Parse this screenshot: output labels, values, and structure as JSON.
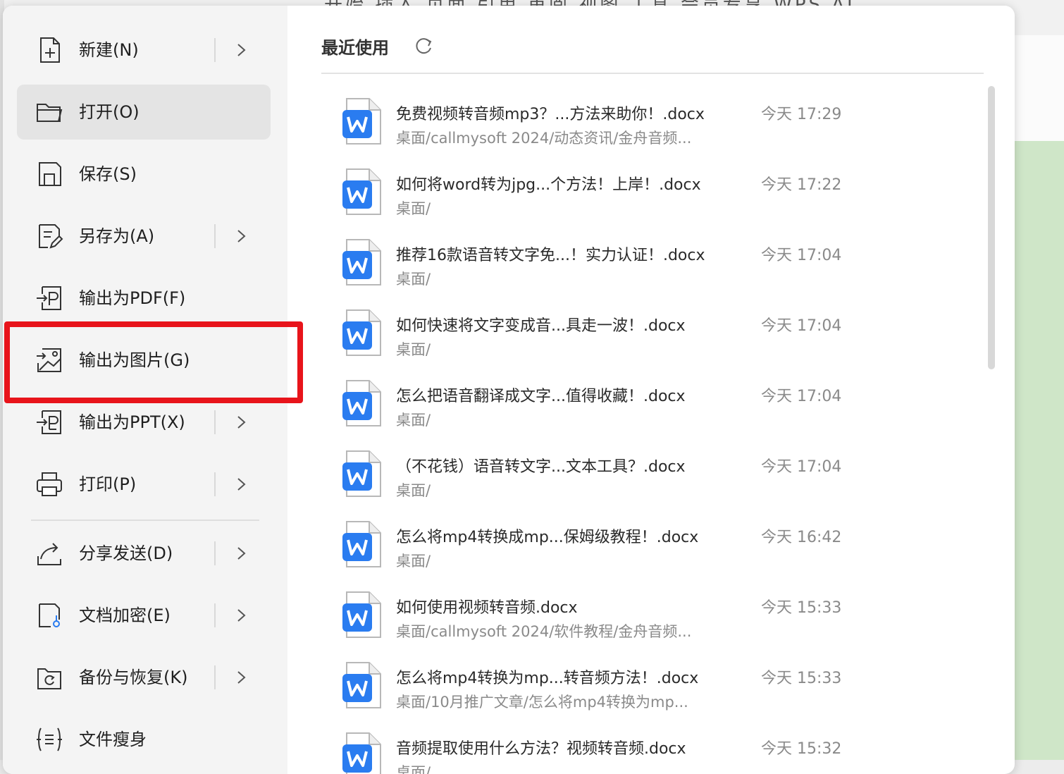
{
  "background": {
    "ribbon_tabs": "开始  插入  页面  引用  审阅  视图  工具  会员专享  WPS AI"
  },
  "menu_left": {
    "items": [
      {
        "label": "新建(N)",
        "icon": "new-document-icon",
        "has_submenu": true
      },
      {
        "label": "打开(O)",
        "icon": "folder-open-icon",
        "has_submenu": false
      },
      {
        "label": "保存(S)",
        "icon": "save-icon",
        "has_submenu": false
      },
      {
        "label": "另存为(A)",
        "icon": "save-as-icon",
        "has_submenu": true
      },
      {
        "label": "输出为PDF(F)",
        "icon": "export-pdf-icon",
        "has_submenu": false
      },
      {
        "label": "输出为图片(G)",
        "icon": "export-image-icon",
        "has_submenu": false
      },
      {
        "label": "输出为PPT(X)",
        "icon": "export-ppt-icon",
        "has_submenu": true
      },
      {
        "label": "打印(P)",
        "icon": "printer-icon",
        "has_submenu": true
      },
      {
        "label": "分享发送(D)",
        "icon": "share-icon",
        "has_submenu": true
      },
      {
        "label": "文档加密(E)",
        "icon": "encrypt-document-icon",
        "has_submenu": true
      },
      {
        "label": "备份与恢复(K)",
        "icon": "backup-restore-icon",
        "has_submenu": true
      },
      {
        "label": "文件瘦身",
        "icon": "file-slim-icon",
        "has_submenu": false
      }
    ]
  },
  "recent": {
    "title": "最近使用",
    "files": [
      {
        "name": "免费视频转音频mp3？...方法来助你！.docx",
        "path": "桌面/callmysoft 2024/动态资讯/金舟音频...",
        "time": "今天 17:29"
      },
      {
        "name": "如何将word转为jpg...个方法！上岸！.docx",
        "path": "桌面/",
        "time": "今天 17:22"
      },
      {
        "name": "推荐16款语音转文字免...！实力认证！.docx",
        "path": "桌面/",
        "time": "今天 17:04"
      },
      {
        "name": "如何快速将文字变成音...具走一波！.docx",
        "path": "桌面/",
        "time": "今天 17:04"
      },
      {
        "name": "怎么把语音翻译成文字...值得收藏！.docx",
        "path": "桌面/",
        "time": "今天 17:04"
      },
      {
        "name": "（不花钱）语音转文字...文本工具？.docx",
        "path": "桌面/",
        "time": "今天 17:04"
      },
      {
        "name": "怎么将mp4转换成mp...保姆级教程！.docx",
        "path": "桌面/",
        "time": "今天 16:42"
      },
      {
        "name": "如何使用视频转音频.docx",
        "path": "桌面/callmysoft 2024/软件教程/金舟音频...",
        "time": "今天 15:33"
      },
      {
        "name": "怎么将mp4转换为mp...转音频方法！.docx",
        "path": "桌面/10月推广文章/怎么将mp4转换为mp...",
        "time": "今天 15:33"
      },
      {
        "name": "音频提取使用什么方法？视频转音频.docx",
        "path": "桌面/",
        "time": "今天 15:32"
      }
    ]
  },
  "colors": {
    "highlight": "#e8141b",
    "word_icon_blue": "#2a7cf0",
    "menu_bg_left": "#f4f4f4",
    "hover_bg": "#e4e4e4"
  }
}
